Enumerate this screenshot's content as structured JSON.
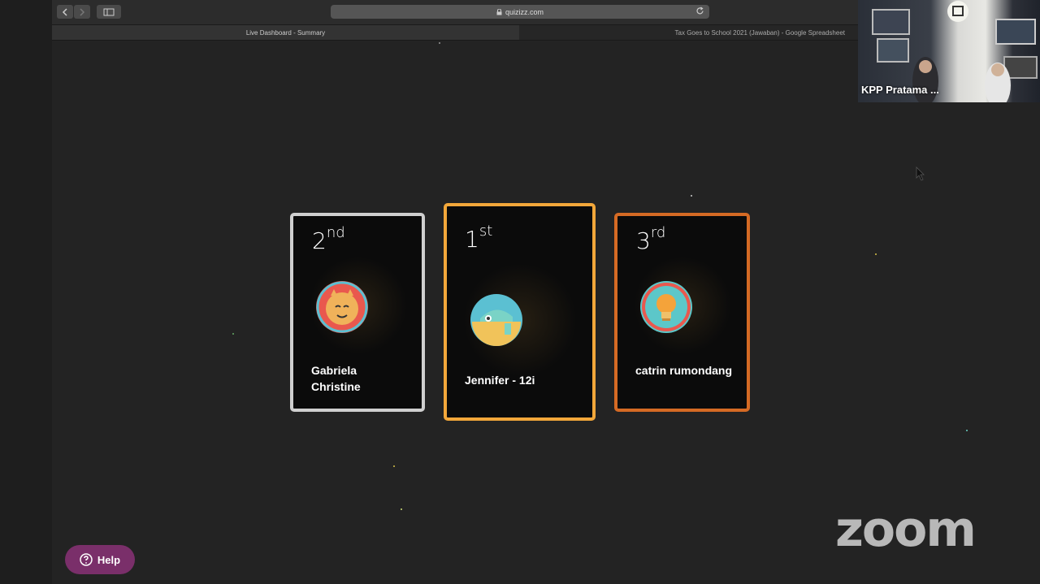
{
  "browser": {
    "url": "quizizz.com",
    "tabs": [
      {
        "label": "Live Dashboard - Summary",
        "active": true
      },
      {
        "label": "Tax Goes to School 2021 (Jawaban) - Google Spreadsheet",
        "active": false
      }
    ]
  },
  "video": {
    "participant_name": "KPP Pratama ..."
  },
  "podium": [
    {
      "place": "2",
      "suffix": "nd",
      "name": "Gabriela Christine",
      "border_color": "#cfcfcf",
      "avatar": "monster-face-icon"
    },
    {
      "place": "1",
      "suffix": "st",
      "name": "Jennifer - 12i",
      "border_color": "#f2a73a",
      "avatar": "chameleon-icon"
    },
    {
      "place": "3",
      "suffix": "rd",
      "name": "catrin rumondang",
      "border_color": "#d56a24",
      "avatar": "lightbulb-icon"
    }
  ],
  "help_button": {
    "label": "Help"
  },
  "branding": {
    "zoom_logo": "zoom"
  },
  "colors": {
    "background": "#232323",
    "gold": "#f2a73a",
    "silver": "#cfcfcf",
    "bronze": "#d56a24",
    "help": "#7a2f6a"
  }
}
